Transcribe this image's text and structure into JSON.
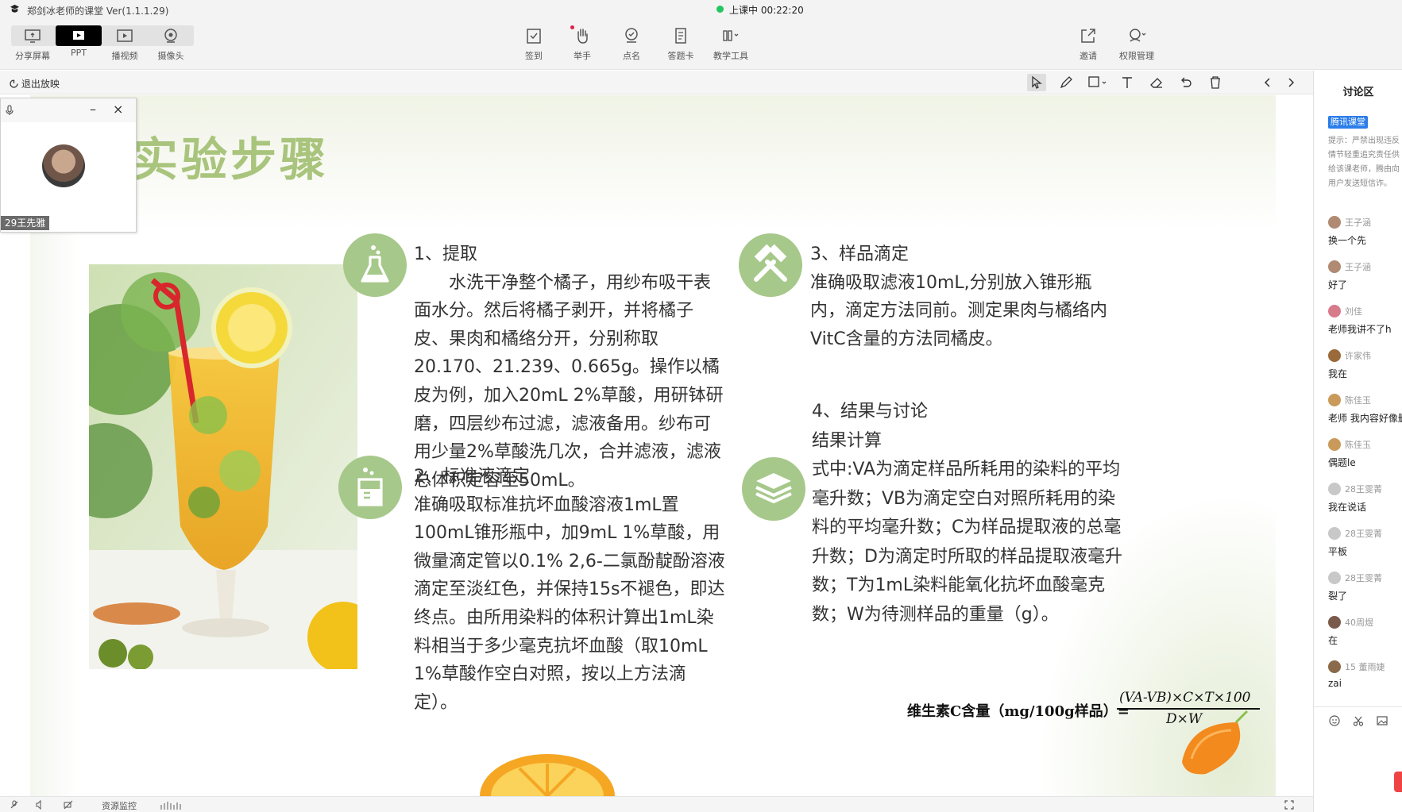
{
  "window": {
    "title": "郑剑冰老师的课堂 Ver(1.1.1.29)",
    "live_status": "上课中 00:22:20"
  },
  "toolbar": {
    "left": [
      {
        "label": "分享屏幕",
        "icon": "share-screen-icon"
      },
      {
        "label": "PPT",
        "icon": "ppt-icon",
        "active": true
      },
      {
        "label": "播视频",
        "icon": "play-video-icon"
      },
      {
        "label": "摄像头",
        "icon": "camera-icon"
      }
    ],
    "center": [
      {
        "label": "签到",
        "icon": "checkin-icon"
      },
      {
        "label": "举手",
        "icon": "raise-hand-icon"
      },
      {
        "label": "点名",
        "icon": "roll-call-icon"
      },
      {
        "label": "答题卡",
        "icon": "answer-card-icon"
      },
      {
        "label": "教学工具",
        "icon": "teaching-tools-icon"
      }
    ],
    "right": [
      {
        "label": "邀请",
        "icon": "invite-icon"
      },
      {
        "label": "权限管理",
        "icon": "permission-icon"
      }
    ]
  },
  "subbar": {
    "exit_label": "退出放映"
  },
  "slide": {
    "title": "实验步骤",
    "step1": {
      "heading": "1、提取",
      "body": "水洗干净整个橘子，用纱布吸干表面水分。然后将橘子剥开，并将橘子皮、果肉和橘络分开，分别称取20.170、21.239、0.665g。操作以橘皮为例，加入20mL 2%草酸，用研钵研磨，四层纱布过滤，滤液备用。纱布可用少量2%草酸洗几次，合并滤液，滤液总体积定容至50mL。"
    },
    "step2": {
      "heading": "2、标准液滴定",
      "body": "准确吸取标准抗坏血酸溶液1mL置100mL锥形瓶中，加9mL 1%草酸，用微量滴定管以0.1% 2,6-二氯酚靛酚溶液滴定至淡红色，并保持15s不褪色，即达终点。由所用染料的体积计算出1mL染料相当于多少毫克抗坏血酸（取10mL 1%草酸作空白对照，按以上方法滴定）。"
    },
    "step3": {
      "heading": "3、样品滴定",
      "body": "准确吸取滤液10mL,分别放入锥形瓶内，滴定方法同前。测定果肉与橘络内VitC含量的方法同橘皮。"
    },
    "step4": {
      "heading": "4、结果与讨论",
      "subheading": "结果计算",
      "body": "式中:VA为滴定样品所耗用的染料的平均毫升数；VB为滴定空白对照所耗用的染料的平均毫升数；C为样品提取液的总毫升数；D为滴定时所取的样品提取液毫升数；T为1mL染料能氧化抗坏血酸毫克数；W为待测样品的重量（g）。"
    },
    "formula": {
      "lhs": "维生素C含量（mg/100g样品）=",
      "numerator": "(VA-VB)×C×T×100",
      "denominator": "D×W"
    }
  },
  "video": {
    "name": "29王先雅"
  },
  "discussion": {
    "title": "讨论区",
    "badge": "腾讯课堂",
    "notice": "提示：严禁出现违反情节轻重追究责任供给该课老师，腾由向用户发送短信诈。",
    "messages": [
      {
        "user": "王子涵",
        "text": "换一个先"
      },
      {
        "user": "王子涵",
        "text": "好了"
      },
      {
        "user": "刘佳",
        "text": "老师我讲不了h"
      },
      {
        "user": "许家伟",
        "text": "我在"
      },
      {
        "user": "陈佳玉",
        "text": "老师 我内容好像删"
      },
      {
        "user": "陈佳玉",
        "text": "偶题le"
      },
      {
        "user": "28王雯菁",
        "text": "我在说话"
      },
      {
        "user": "28王雯菁",
        "text": "平板"
      },
      {
        "user": "28王雯菁",
        "text": "裂了"
      },
      {
        "user": "40周煜",
        "text": "在"
      },
      {
        "user": "15 董雨婕",
        "text": "zai"
      }
    ]
  },
  "bottombar": {
    "resource_label": "资源监控"
  },
  "colors": {
    "accent_green": "#a6c88a",
    "title_green": "#a9c47c",
    "live_dot": "#22c55e",
    "badge_blue": "#2b7de9"
  }
}
